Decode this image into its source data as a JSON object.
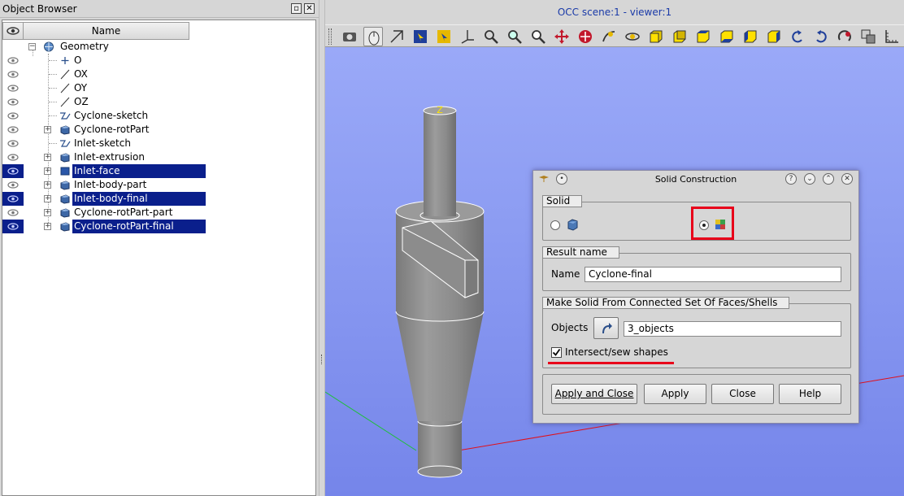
{
  "object_browser": {
    "title": "Object Browser",
    "column_name": "Name",
    "root": "Geometry",
    "items": [
      {
        "label": "O",
        "selected": false
      },
      {
        "label": "OX",
        "selected": false
      },
      {
        "label": "OY",
        "selected": false
      },
      {
        "label": "OZ",
        "selected": false
      },
      {
        "label": "Cyclone-sketch",
        "selected": false
      },
      {
        "label": "Cyclone-rotPart",
        "selected": false
      },
      {
        "label": "Inlet-sketch",
        "selected": false
      },
      {
        "label": "Inlet-extrusion",
        "selected": false
      },
      {
        "label": "Inlet-face",
        "selected": true
      },
      {
        "label": "Inlet-body-part",
        "selected": false
      },
      {
        "label": "Inlet-body-final",
        "selected": true
      },
      {
        "label": "Cyclone-rotPart-part",
        "selected": false
      },
      {
        "label": "Cyclone-rotPart-final",
        "selected": true
      }
    ]
  },
  "viewer": {
    "title": "OCC scene:1 - viewer:1",
    "axis_label": "Z",
    "toolbar_icons": [
      "dump-view-icon",
      "interaction-style-icon",
      "zoom-style-icon",
      "select-rect-icon",
      "dynamic-preselection-icon",
      "show-trihedron-icon",
      "fit-all-icon",
      "fit-area-icon",
      "zoom-icon",
      "pan-icon",
      "global-pan-icon",
      "rotation-point-icon",
      "rotate-icon",
      "front-view-icon",
      "back-view-icon",
      "top-view-icon",
      "bottom-view-icon",
      "left-view-icon",
      "right-view-icon",
      "rotate-counterclockwise-icon",
      "rotate-clockwise-icon",
      "reset-view-icon",
      "clone-view-icon",
      "graduated-axes-icon"
    ]
  },
  "dialog": {
    "title": "Solid Construction",
    "solid_group": "Solid",
    "result_group": "Result name",
    "name_label": "Name",
    "name_value": "Cyclone-final",
    "make_group": "Make Solid From Connected Set Of Faces/Shells",
    "objects_label": "Objects",
    "objects_value": "3_objects",
    "intersect_label": "Intersect/sew shapes",
    "intersect_checked": true,
    "btn_apply_close": "Apply and Close",
    "btn_apply": "Apply",
    "btn_close": "Close",
    "btn_help": "Help"
  },
  "colors": {
    "selection": "#0a1f8c",
    "highlight_annotation": "#e8001a",
    "viewer_bg": "#8c9cf2"
  }
}
